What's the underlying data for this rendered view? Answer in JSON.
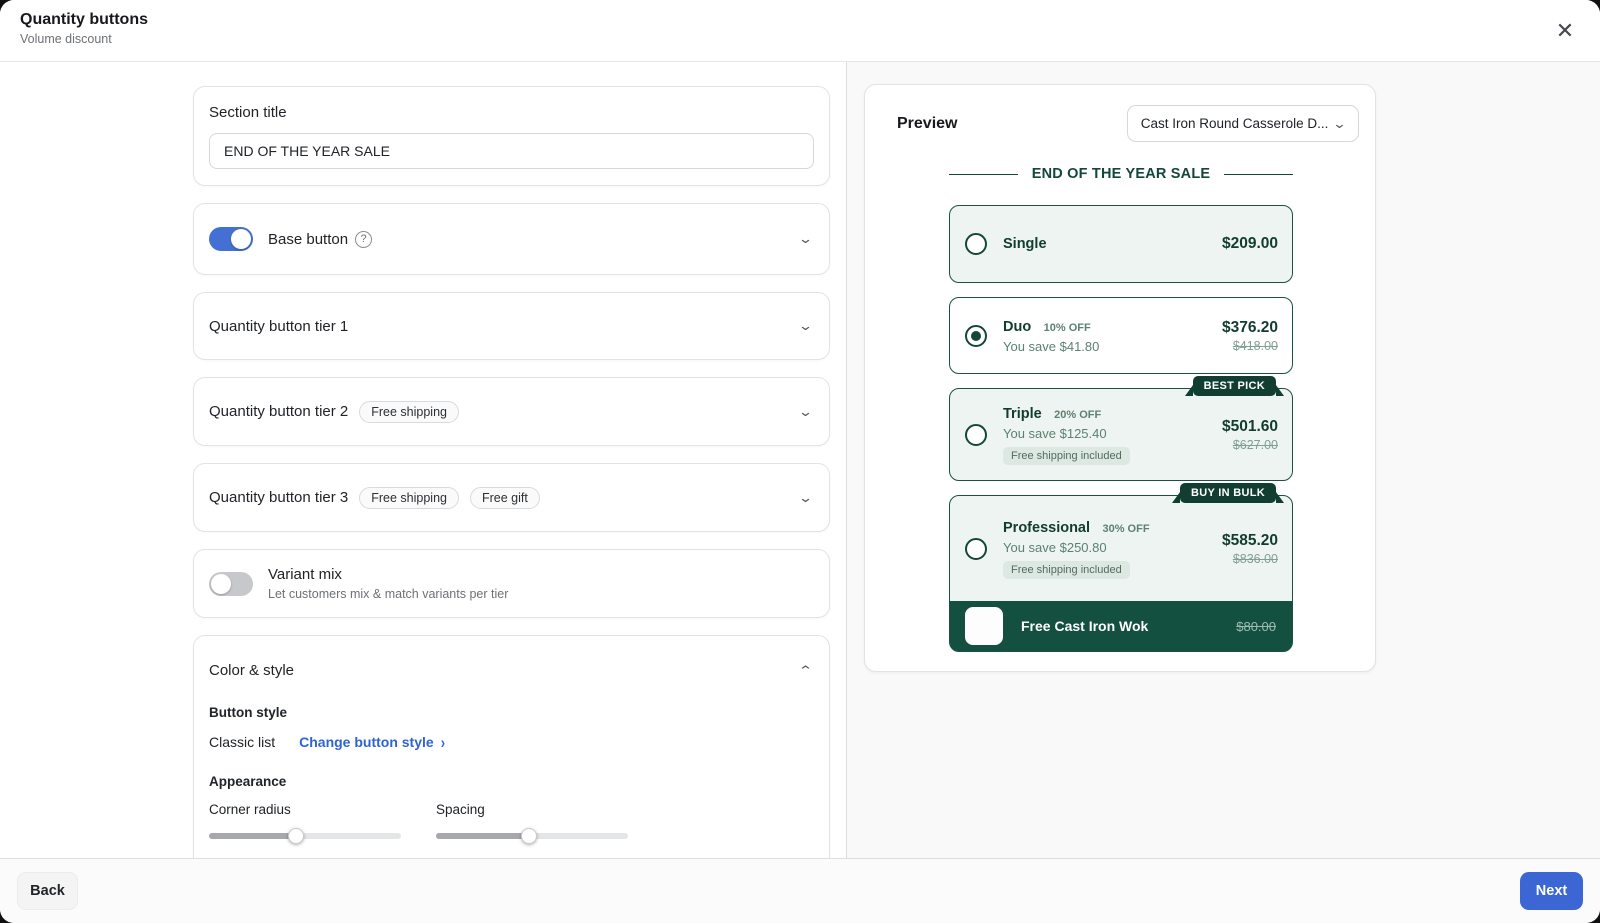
{
  "header": {
    "title": "Quantity buttons",
    "subtitle": "Volume discount",
    "close_icon": "✕"
  },
  "settings": {
    "section_title": {
      "label": "Section title",
      "value": "END OF THE YEAR SALE"
    },
    "base_button": {
      "label": "Base button",
      "toggle_on": true,
      "help_icon": "?"
    },
    "tiers": [
      {
        "label": "Quantity button tier 1",
        "badges": []
      },
      {
        "label": "Quantity button tier 2",
        "badges": [
          "Free shipping"
        ]
      },
      {
        "label": "Quantity button tier 3",
        "badges": [
          "Free shipping",
          "Free gift"
        ]
      }
    ],
    "variant_mix": {
      "label": "Variant mix",
      "description": "Let customers mix & match variants per tier",
      "toggle_on": false
    },
    "color_style": {
      "label": "Color & style",
      "button_style_heading": "Button style",
      "button_style_value": "Classic list",
      "change_button_link": "Change button style",
      "appearance_heading": "Appearance",
      "corner_radius_label": "Corner radius",
      "spacing_label": "Spacing",
      "corner_radius_percent": 45,
      "spacing_percent": 48
    }
  },
  "preview": {
    "label": "Preview",
    "product_selector": "Cast Iron Round Casserole D...",
    "sale_title": "END OF THE YEAR SALE",
    "options": [
      {
        "name": "Single",
        "price": "$209.00",
        "selected": false
      },
      {
        "name": "Duo",
        "discount": "10% OFF",
        "save": "You save $41.80",
        "price": "$376.20",
        "old_price": "$418.00",
        "selected": true
      },
      {
        "name": "Triple",
        "discount": "20% OFF",
        "save": "You save $125.40",
        "chip": "Free shipping included",
        "badge": "BEST PICK",
        "price": "$501.60",
        "old_price": "$627.00",
        "selected": false
      },
      {
        "name": "Professional",
        "discount": "30% OFF",
        "save": "You save $250.80",
        "chip": "Free shipping included",
        "badge": "BUY IN BULK",
        "price": "$585.20",
        "old_price": "$836.00",
        "selected": false,
        "gift": {
          "name": "Free Cast Iron Wok",
          "old_price": "$80.00"
        }
      }
    ]
  },
  "footer": {
    "back_label": "Back",
    "next_label": "Next"
  },
  "colors": {
    "accent_green": "#14503f",
    "badge_green": "#123e32",
    "tint_green": "#eef4f1",
    "toggle_blue": "#4470d4",
    "button_blue": "#3b66d4",
    "link_blue": "#2e63d6"
  }
}
